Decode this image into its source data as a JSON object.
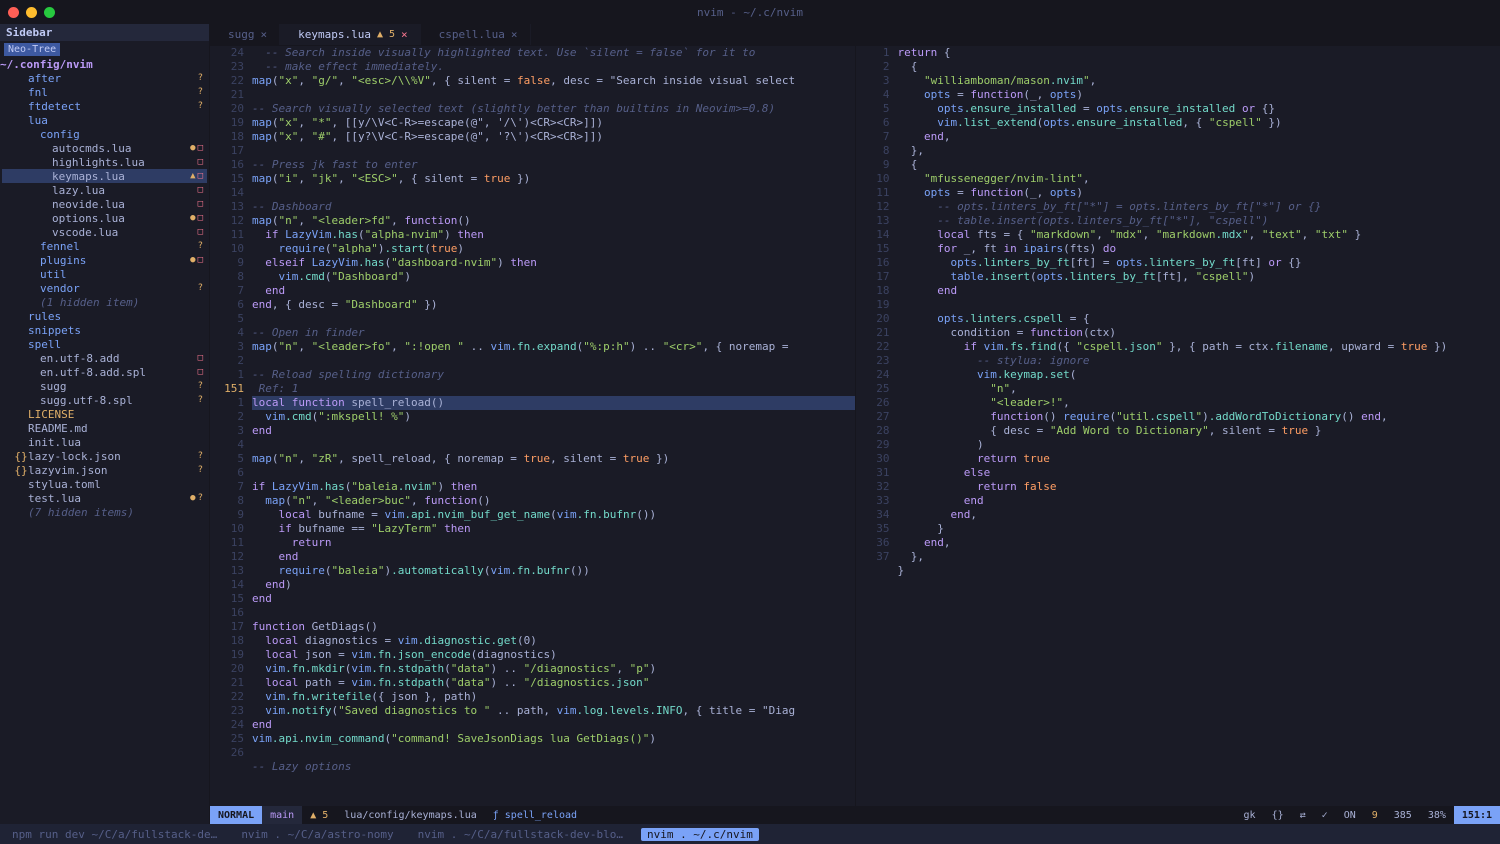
{
  "window": {
    "title": "nvim - ~/.c/nvim"
  },
  "sidebar": {
    "header": "Sidebar",
    "neoTree": "Neo-Tree",
    "root": " ~/.config/nvim",
    "items": [
      {
        "d": 1,
        "icon": "dir",
        "name": " after",
        "dir": true,
        "status": [
          "?"
        ]
      },
      {
        "d": 1,
        "icon": "dir",
        "name": " fnl",
        "dir": true,
        "status": [
          "?"
        ]
      },
      {
        "d": 1,
        "icon": "dir",
        "name": " ftdetect",
        "dir": true,
        "status": [
          "?"
        ]
      },
      {
        "d": 1,
        "icon": "dir",
        "name": " lua",
        "dir": true
      },
      {
        "d": 2,
        "icon": "dir",
        "name": " config",
        "dir": true
      },
      {
        "d": 3,
        "icon": "lua",
        "name": "autocmds.lua",
        "status": [
          "●",
          "□"
        ]
      },
      {
        "d": 3,
        "icon": "lua",
        "name": "highlights.lua",
        "status": [
          "□"
        ]
      },
      {
        "d": 3,
        "icon": "lua",
        "name": "keymaps.lua",
        "active": true,
        "status": [
          "▲",
          "□"
        ]
      },
      {
        "d": 3,
        "icon": "lua",
        "name": "lazy.lua",
        "status": [
          "□"
        ]
      },
      {
        "d": 3,
        "icon": "lua",
        "name": "neovide.lua",
        "status": [
          "□"
        ]
      },
      {
        "d": 3,
        "icon": "lua",
        "name": "options.lua",
        "status": [
          "●",
          "□"
        ]
      },
      {
        "d": 3,
        "icon": "lua",
        "name": "vscode.lua",
        "status": [
          "□"
        ]
      },
      {
        "d": 2,
        "icon": "dir",
        "name": " fennel",
        "dir": true,
        "status": [
          "?"
        ]
      },
      {
        "d": 2,
        "icon": "dir",
        "name": " plugins",
        "dir": true,
        "status": [
          "●",
          "□"
        ]
      },
      {
        "d": 2,
        "icon": "dir",
        "name": " util",
        "dir": true
      },
      {
        "d": 2,
        "icon": "dir",
        "name": " vendor",
        "dir": true,
        "status": [
          "?"
        ]
      },
      {
        "d": 2,
        "icon": "",
        "name": "(1 hidden item)",
        "hidden": true
      },
      {
        "d": 1,
        "icon": "dir",
        "name": " rules",
        "dir": true
      },
      {
        "d": 1,
        "icon": "dir",
        "name": " snippets",
        "dir": true
      },
      {
        "d": 1,
        "icon": "dir",
        "name": " spell",
        "dir": true
      },
      {
        "d": 2,
        "icon": "file",
        "name": "en.utf-8.add",
        "status": [
          "□"
        ]
      },
      {
        "d": 2,
        "icon": "file",
        "name": "en.utf-8.add.spl",
        "status": [
          "□"
        ]
      },
      {
        "d": 2,
        "icon": "file",
        "name": "sugg",
        "status": [
          "?"
        ]
      },
      {
        "d": 2,
        "icon": "file",
        "name": "sugg.utf-8.spl",
        "status": [
          "?"
        ]
      },
      {
        "d": 1,
        "icon": "file",
        "name": "LICENSE",
        "gold": true
      },
      {
        "d": 1,
        "icon": "md",
        "name": "README.md"
      },
      {
        "d": 1,
        "icon": "lua",
        "name": "init.lua"
      },
      {
        "d": 1,
        "icon": "json",
        "name": "lazy-lock.json",
        "status": [
          "?"
        ]
      },
      {
        "d": 1,
        "icon": "json",
        "name": "lazyvim.json",
        "status": [
          "?"
        ]
      },
      {
        "d": 1,
        "icon": "file",
        "name": "stylua.toml"
      },
      {
        "d": 1,
        "icon": "lua",
        "name": "test.lua",
        "status": [
          "●",
          "?"
        ]
      },
      {
        "d": 1,
        "icon": "",
        "name": "(7 hidden items)",
        "hidden": true
      }
    ]
  },
  "tabs": [
    {
      "icon": "",
      "label": "sugg",
      "active": false,
      "closeRed": false
    },
    {
      "icon": "",
      "label": "keymaps.lua",
      "badge": "▲ 5",
      "active": true,
      "closeRed": true
    },
    {
      "icon": "",
      "label": "cspell.lua",
      "active": false,
      "closeRed": false
    }
  ],
  "leftPane": {
    "gutter": [
      "24",
      "23",
      "22",
      "21",
      "20",
      "19",
      "18",
      "17",
      "16",
      "15",
      "14",
      "13",
      "12",
      "11",
      "10",
      "9",
      "8",
      "7",
      "6",
      "5",
      "4",
      "3",
      "2",
      "1",
      "151",
      "1",
      "2",
      "3",
      "4",
      "5",
      "6",
      "7",
      "8",
      "9",
      "10",
      "11",
      "12",
      "13",
      "14",
      "15",
      "16",
      "17",
      "18",
      "19",
      "20",
      "21",
      "22",
      "23",
      "24",
      "25",
      "26"
    ],
    "currentLine": "151",
    "lines": [
      {
        "cls": "c-comment",
        "t": "  -- Search inside visually highlighted text. Use `silent = false` for it to"
      },
      {
        "cls": "c-comment",
        "t": "  -- make effect immediately."
      },
      {
        "t": "map(\"x\", \"g/\", \"<esc>/\\\\%V\", { silent = false, desc = \"Search inside visual select"
      },
      {
        "t": ""
      },
      {
        "cls": "c-comment",
        "t": "-- Search visually selected text (slightly better than builtins in Neovim>=0.8)"
      },
      {
        "t": "map(\"x\", \"*\", [[y/\\V<C-R>=escape(@\", '/\\')<CR><CR>]])"
      },
      {
        "t": "map(\"x\", \"#\", [[y?\\V<C-R>=escape(@\", '?\\')<CR><CR>]])"
      },
      {
        "t": ""
      },
      {
        "cls": "c-comment",
        "t": "-- Press jk fast to enter"
      },
      {
        "t": "map(\"i\", \"jk\", \"<ESC>\", { silent = true })"
      },
      {
        "t": ""
      },
      {
        "cls": "c-comment",
        "t": "-- Dashboard"
      },
      {
        "t": "map(\"n\", \"<leader>fd\", function()"
      },
      {
        "t": "  if LazyVim.has(\"alpha-nvim\") then"
      },
      {
        "t": "    require(\"alpha\").start(true)"
      },
      {
        "t": "  elseif LazyVim.has(\"dashboard-nvim\") then"
      },
      {
        "t": "    vim.cmd(\"Dashboard\")"
      },
      {
        "t": "  end"
      },
      {
        "t": "end, { desc = \"Dashboard\" })"
      },
      {
        "t": ""
      },
      {
        "cls": "c-comment",
        "t": "-- Open in finder"
      },
      {
        "t": "map(\"n\", \"<leader>fo\", \":!open \" .. vim.fn.expand(\"%:p:h\") .. \"<cr>\", { noremap ="
      },
      {
        "t": ""
      },
      {
        "cls": "c-comment",
        "t": "-- Reload spelling dictionary"
      },
      {
        "cls": "c-comment",
        "t": " Ref: 1"
      },
      {
        "hl": true,
        "t": "local function spell_reload()"
      },
      {
        "t": "  vim.cmd(\":mkspell! %\")"
      },
      {
        "t": "end"
      },
      {
        "t": ""
      },
      {
        "t": "map(\"n\", \"zR\", spell_reload, { noremap = true, silent = true })"
      },
      {
        "t": ""
      },
      {
        "t": "if LazyVim.has(\"baleia.nvim\") then"
      },
      {
        "t": "  map(\"n\", \"<leader>buc\", function()"
      },
      {
        "t": "    local bufname = vim.api.nvim_buf_get_name(vim.fn.bufnr())"
      },
      {
        "t": "    if bufname == \"LazyTerm\" then"
      },
      {
        "t": "      return"
      },
      {
        "t": "    end"
      },
      {
        "t": "    require(\"baleia\").automatically(vim.fn.bufnr())"
      },
      {
        "t": "  end)"
      },
      {
        "t": "end"
      },
      {
        "t": ""
      },
      {
        "t": "function GetDiags()"
      },
      {
        "t": "  local diagnostics = vim.diagnostic.get(0)"
      },
      {
        "t": "  local json = vim.fn.json_encode(diagnostics)"
      },
      {
        "t": "  vim.fn.mkdir(vim.fn.stdpath(\"data\") .. \"/diagnostics\", \"p\")"
      },
      {
        "t": "  local path = vim.fn.stdpath(\"data\") .. \"/diagnostics.json\""
      },
      {
        "t": "  vim.fn.writefile({ json }, path)"
      },
      {
        "t": "  vim.notify(\"Saved diagnostics to \" .. path, vim.log.levels.INFO, { title = \"Diag"
      },
      {
        "t": "end"
      },
      {
        "t": "vim.api.nvim_command(\"command! SaveJsonDiags lua GetDiags()\")"
      },
      {
        "t": ""
      },
      {
        "cls": "c-comment",
        "t": "-- Lazy options"
      }
    ]
  },
  "rightPane": {
    "gutter": [
      "1",
      "2",
      "3",
      "4",
      "5",
      "6",
      "7",
      "8",
      "9",
      "10",
      "11",
      "12",
      "13",
      "14",
      "15",
      "16",
      "17",
      "18",
      "19",
      "20",
      "21",
      "22",
      "23",
      "24",
      "25",
      "26",
      "27",
      "28",
      "29",
      "30",
      "31",
      "32",
      "33",
      "34",
      "35",
      "36",
      "37"
    ],
    "lines": [
      {
        "t": "return {"
      },
      {
        "t": "  {"
      },
      {
        "t": "    \"williamboman/mason.nvim\","
      },
      {
        "t": "    opts = function(_, opts)"
      },
      {
        "t": "      opts.ensure_installed = opts.ensure_installed or {}"
      },
      {
        "t": "      vim.list_extend(opts.ensure_installed, { \"cspell\" })"
      },
      {
        "t": "    end,"
      },
      {
        "t": "  },"
      },
      {
        "t": "  {"
      },
      {
        "t": "    \"mfussenegger/nvim-lint\","
      },
      {
        "t": "    opts = function(_, opts)"
      },
      {
        "cls": "c-comment",
        "t": "      -- opts.linters_by_ft[\"*\"] = opts.linters_by_ft[\"*\"] or {}"
      },
      {
        "cls": "c-comment",
        "t": "      -- table.insert(opts.linters_by_ft[\"*\"], \"cspell\")"
      },
      {
        "t": "      local fts = { \"markdown\", \"mdx\", \"markdown.mdx\", \"text\", \"txt\" }"
      },
      {
        "t": "      for _, ft in ipairs(fts) do"
      },
      {
        "t": "        opts.linters_by_ft[ft] = opts.linters_by_ft[ft] or {}"
      },
      {
        "t": "        table.insert(opts.linters_by_ft[ft], \"cspell\")"
      },
      {
        "t": "      end"
      },
      {
        "t": ""
      },
      {
        "t": "      opts.linters.cspell = {"
      },
      {
        "t": "        condition = function(ctx)"
      },
      {
        "t": "          if vim.fs.find({ \"cspell.json\" }, { path = ctx.filename, upward = true })"
      },
      {
        "cls": "c-comment",
        "t": "            -- stylua: ignore"
      },
      {
        "t": "            vim.keymap.set("
      },
      {
        "t": "              \"n\","
      },
      {
        "t": "              \"<leader>!\","
      },
      {
        "t": "              function() require(\"util.cspell\").addWordToDictionary() end,"
      },
      {
        "t": "              { desc = \"Add Word to Dictionary\", silent = true }"
      },
      {
        "t": "            )"
      },
      {
        "t": "            return true"
      },
      {
        "t": "          else"
      },
      {
        "t": "            return false"
      },
      {
        "t": "          end"
      },
      {
        "t": "        end,"
      },
      {
        "t": "      }"
      },
      {
        "t": "    end,"
      },
      {
        "t": "  },"
      },
      {
        "t": "}"
      }
    ]
  },
  "statusline": {
    "mode": "NORMAL",
    "branch": " main",
    "diag": "▲ 5",
    "path": " lua/config/keymaps.lua",
    "func": "ƒ spell_reload",
    "right": {
      "gk": "gk",
      "braces": "{}",
      "shuffle": "⇄",
      "lsp": "",
      "fmt": "",
      "check": "✓",
      "on": "ON",
      "diag9": " 9",
      "lines": " 385",
      "pct": "38%",
      "pos": "151:1"
    }
  },
  "tmux": [
    {
      "label": "npm run dev ~/C/a/fullstack-de…",
      "active": false
    },
    {
      "label": "nvim . ~/C/a/astro-nomy",
      "active": false
    },
    {
      "label": "nvim . ~/C/a/fullstack-dev-blo…",
      "active": false
    },
    {
      "label": "nvim . ~/.c/nvim",
      "active": true
    }
  ]
}
